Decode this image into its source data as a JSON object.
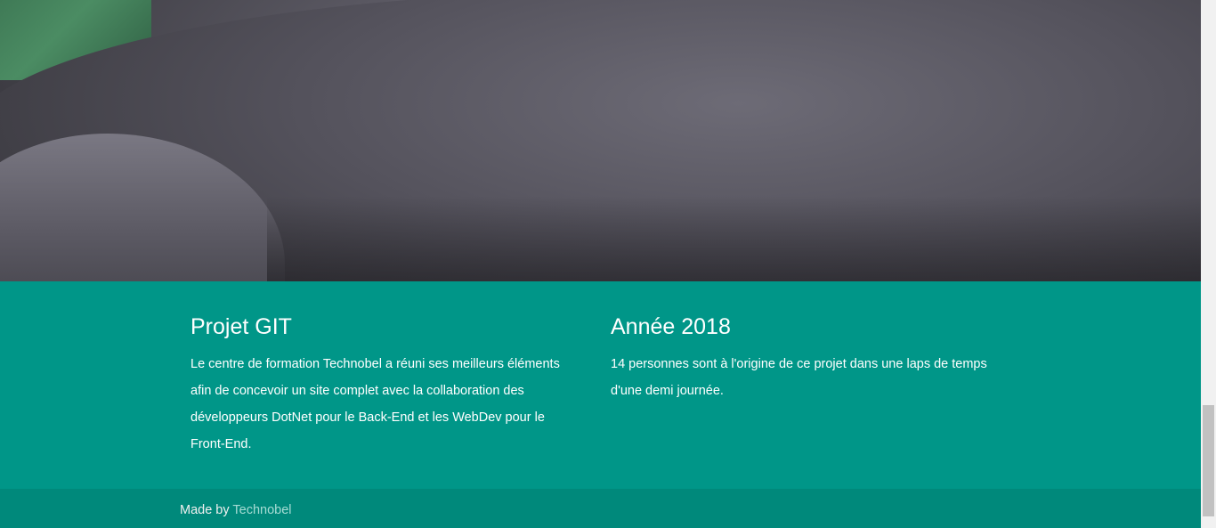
{
  "hero": {
    "image": "seal-photo"
  },
  "projet": {
    "title": "Projet GIT",
    "text": "Le centre de formation Technobel a réuni ses meilleurs éléments afin de concevoir un site complet avec la collaboration des développeurs DotNet pour le Back-End et les WebDev pour le Front-End."
  },
  "annee": {
    "title": "Année 2018",
    "text": "14 personnes sont à l'origine de ce projet dans une laps de temps d'une demi journée."
  },
  "footer": {
    "made_by": "Made by",
    "link": "Technobel"
  },
  "colors": {
    "teal": "#009688",
    "footer_teal": "#00897b",
    "link": "#a6dcd4"
  }
}
